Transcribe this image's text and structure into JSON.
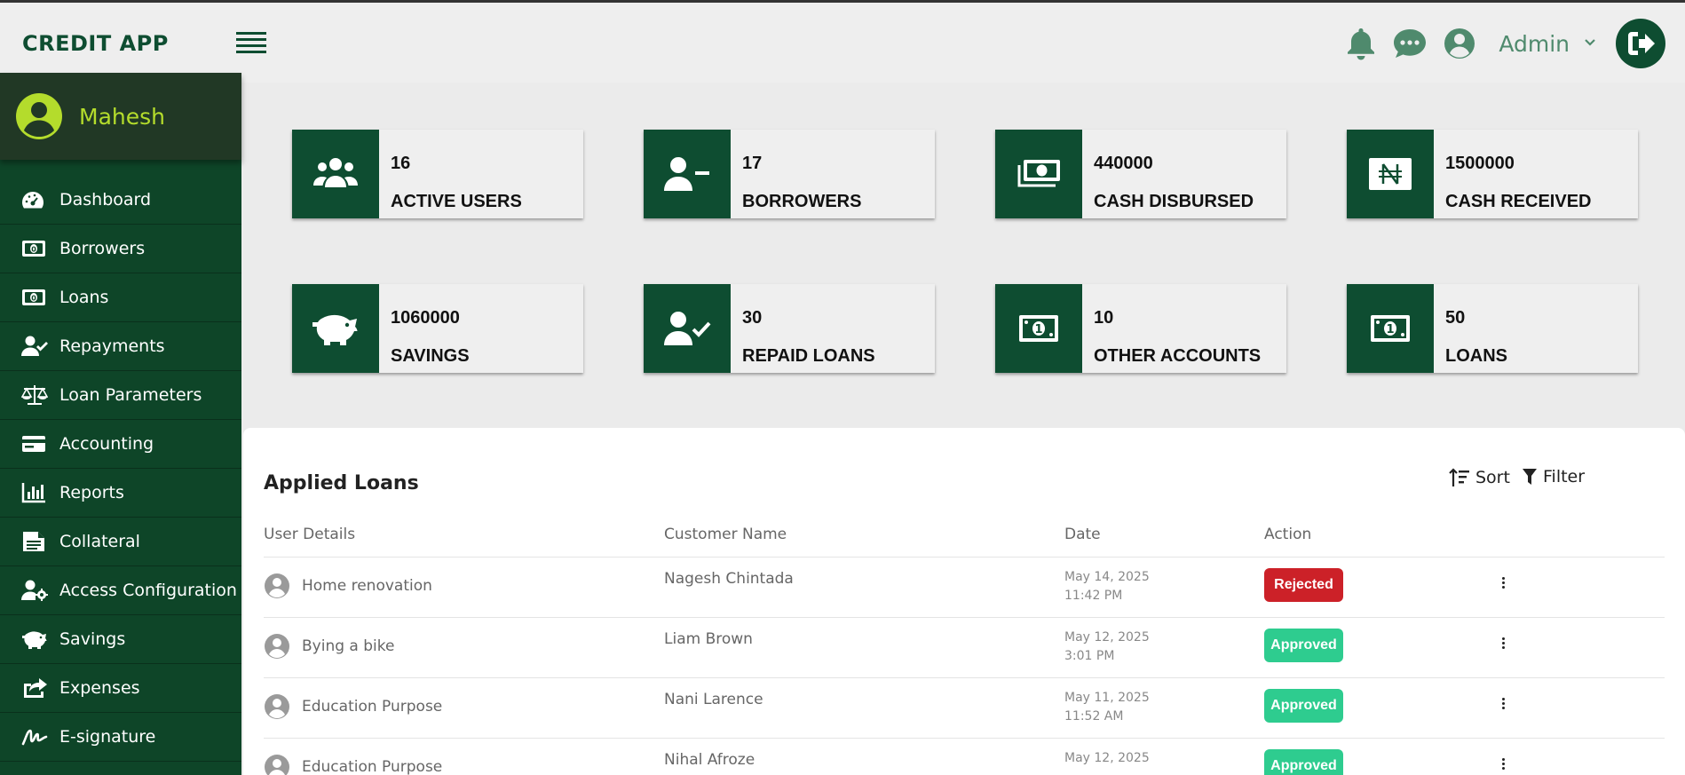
{
  "app": {
    "brand": "CREDIT APP"
  },
  "header": {
    "user_label": "Admin"
  },
  "sidebar": {
    "profile_name": "Mahesh",
    "items": [
      {
        "label": "Dashboard",
        "icon": "gauge-icon"
      },
      {
        "label": "Borrowers",
        "icon": "money-bill-icon"
      },
      {
        "label": "Loans",
        "icon": "money-bill-icon"
      },
      {
        "label": "Repayments",
        "icon": "user-check-icon"
      },
      {
        "label": "Loan Parameters",
        "icon": "scale-icon"
      },
      {
        "label": "Accounting",
        "icon": "credit-card-icon"
      },
      {
        "label": "Reports",
        "icon": "bar-chart-icon"
      },
      {
        "label": "Collateral",
        "icon": "document-icon"
      },
      {
        "label": "Access Configuration",
        "icon": "user-gear-icon"
      },
      {
        "label": "Savings",
        "icon": "piggy-bank-icon"
      },
      {
        "label": "Expenses",
        "icon": "share-icon"
      },
      {
        "label": "E-signature",
        "icon": "signature-icon"
      }
    ]
  },
  "stats": [
    {
      "value": "16",
      "label": "ACTIVE USERS",
      "icon": "users-icon"
    },
    {
      "value": "17",
      "label": "BORROWERS",
      "icon": "user-minus-icon"
    },
    {
      "value": "440000",
      "label": "CASH DISBURSED",
      "icon": "money-stack-icon"
    },
    {
      "value": "1500000",
      "label": "CASH RECEIVED",
      "icon": "naira-icon"
    },
    {
      "value": "1060000",
      "label": "SAVINGS",
      "icon": "piggy-bank-icon"
    },
    {
      "value": "30",
      "label": "REPAID LOANS",
      "icon": "user-check-icon"
    },
    {
      "value": "10",
      "label": "OTHER ACCOUNTS",
      "icon": "money-bill-icon"
    },
    {
      "value": "50",
      "label": "LOANS",
      "icon": "money-bill-icon"
    }
  ],
  "loans_panel": {
    "title": "Applied Loans",
    "sort_label": "Sort",
    "filter_label": "Filter",
    "columns": [
      "User Details",
      "Customer Name",
      "Date",
      "Action"
    ],
    "rows": [
      {
        "purpose": "Home renovation",
        "customer": "Nagesh Chintada",
        "date": "May 14, 2025",
        "time": "11:42 PM",
        "status": "Rejected"
      },
      {
        "purpose": "Bying a bike",
        "customer": "Liam Brown",
        "date": "May 12, 2025",
        "time": "3:01 PM",
        "status": "Approved"
      },
      {
        "purpose": "Education Purpose",
        "customer": "Nani Larence",
        "date": "May 11, 2025",
        "time": "11:52 AM",
        "status": "Approved"
      },
      {
        "purpose": "Education Purpose",
        "customer": "Nihal Afroze",
        "date": "May 12, 2025",
        "time": "",
        "status": "Approved"
      }
    ]
  },
  "colors": {
    "primary": "#0e4d31",
    "sidebar": "#0e4528",
    "accent_lime": "#b4dc2c",
    "rejected": "#cc2128",
    "approved": "#2ecc8f"
  }
}
